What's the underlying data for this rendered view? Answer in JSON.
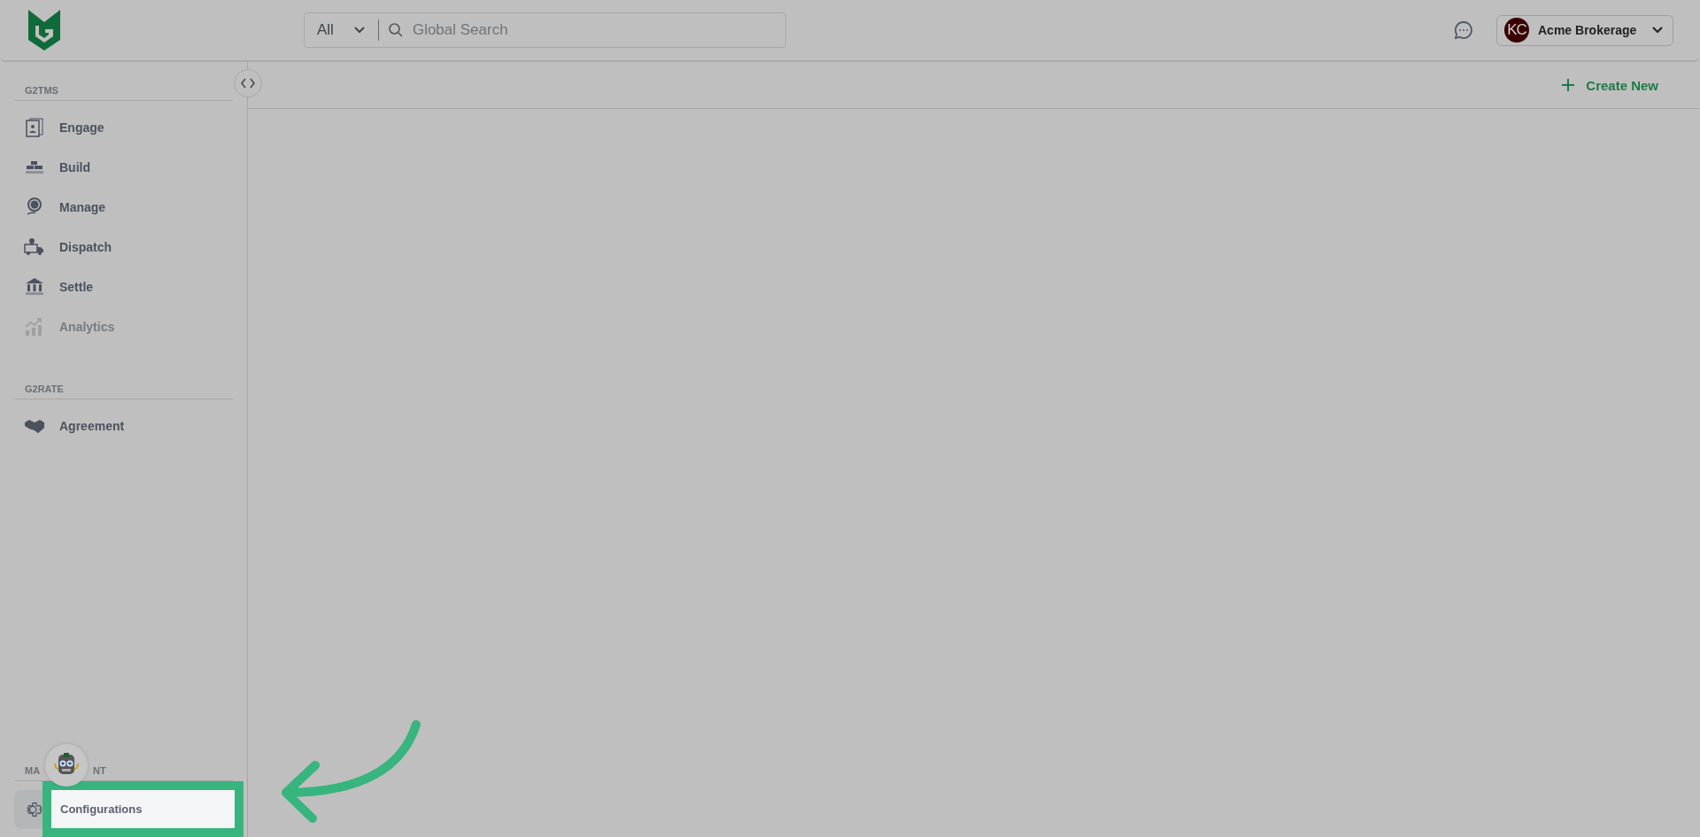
{
  "header": {
    "search_scope": "All",
    "search_placeholder": "Global Search",
    "account": {
      "initials": "KC",
      "name": "Acme Brokerage"
    }
  },
  "toolbar": {
    "create_button": "Create New"
  },
  "sidebar": {
    "sections": [
      {
        "title": "G2TMS",
        "items": [
          {
            "label": "Engage",
            "disabled": false
          },
          {
            "label": "Build",
            "disabled": false
          },
          {
            "label": "Manage",
            "disabled": false
          },
          {
            "label": "Dispatch",
            "disabled": false
          },
          {
            "label": "Settle",
            "disabled": false
          },
          {
            "label": "Analytics",
            "disabled": true
          }
        ]
      },
      {
        "title": "G2RATE",
        "items": [
          {
            "label": "Agreement",
            "disabled": false
          }
        ]
      }
    ],
    "management": {
      "heading_parts": [
        "MA",
        "NT"
      ],
      "tooltip": "Configurations"
    }
  }
}
